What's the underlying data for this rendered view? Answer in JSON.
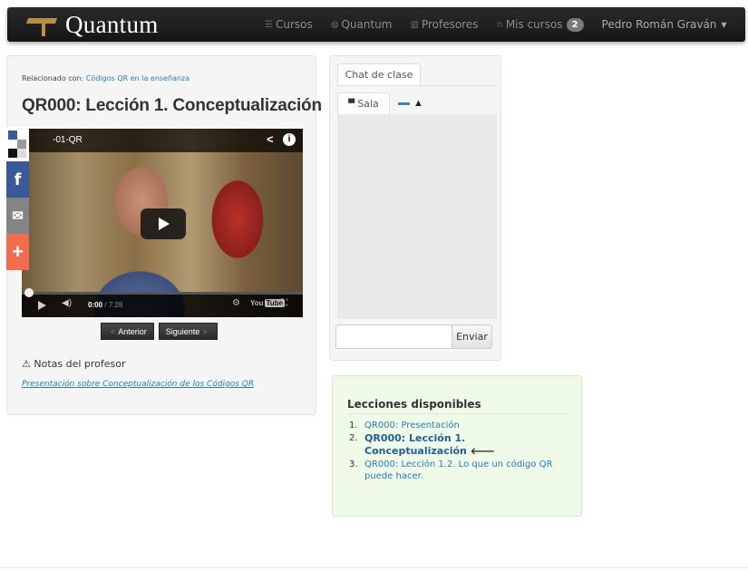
{
  "navbar": {
    "brand": "Quantum",
    "items": [
      {
        "label": "Cursos",
        "icon": "list-icon"
      },
      {
        "label": "Quantum",
        "icon": "globe-icon"
      },
      {
        "label": "Profesores",
        "icon": "building-icon"
      },
      {
        "label": "Mis cursos",
        "icon": "headphones-icon",
        "badge": "2"
      }
    ],
    "user": "Pedro Román Graván"
  },
  "lesson": {
    "related_prefix": "Relacionado con:",
    "related_link": "Códigos QR en la enseñanza",
    "title": "QR000: Lección 1. Conceptualización",
    "video": {
      "title": "-01-QR",
      "time_current": "0:00",
      "time_total": "/ 7:28",
      "progress": 0,
      "youtube_label": "You",
      "youtube_tube": "Tube"
    },
    "prev_button": "Anterior",
    "next_button": "Siguiente",
    "notes_title": "Notas del profesor",
    "notes_link": "Presentación sobre Conceptualización de los Códigos QR"
  },
  "share": {
    "facebook_glyph": "f",
    "mail_glyph": "✉",
    "more_glyph": "+"
  },
  "chat": {
    "tab_label": "Chat de clase",
    "room_tab": "Sala",
    "send_button": "Enviar",
    "input_value": ""
  },
  "lessons": {
    "title": "Lecciones disponibles",
    "items": [
      {
        "num": "1.",
        "label": "QR000: Presentación",
        "current": false
      },
      {
        "num": "2.",
        "label": "QR000: Lección 1. Conceptualización",
        "current": true
      },
      {
        "num": "3.",
        "label": "QR000: Lección 1.2. Lo que un código QR puede hacer.",
        "current": false
      }
    ]
  },
  "colors": {
    "navbar": "#1c1c1c",
    "brand_accent": "#b98f43",
    "link": "#2a7ab8",
    "lessons_bg": "#effae9",
    "facebook": "#3b5998",
    "share_plus": "#f26c4f"
  }
}
